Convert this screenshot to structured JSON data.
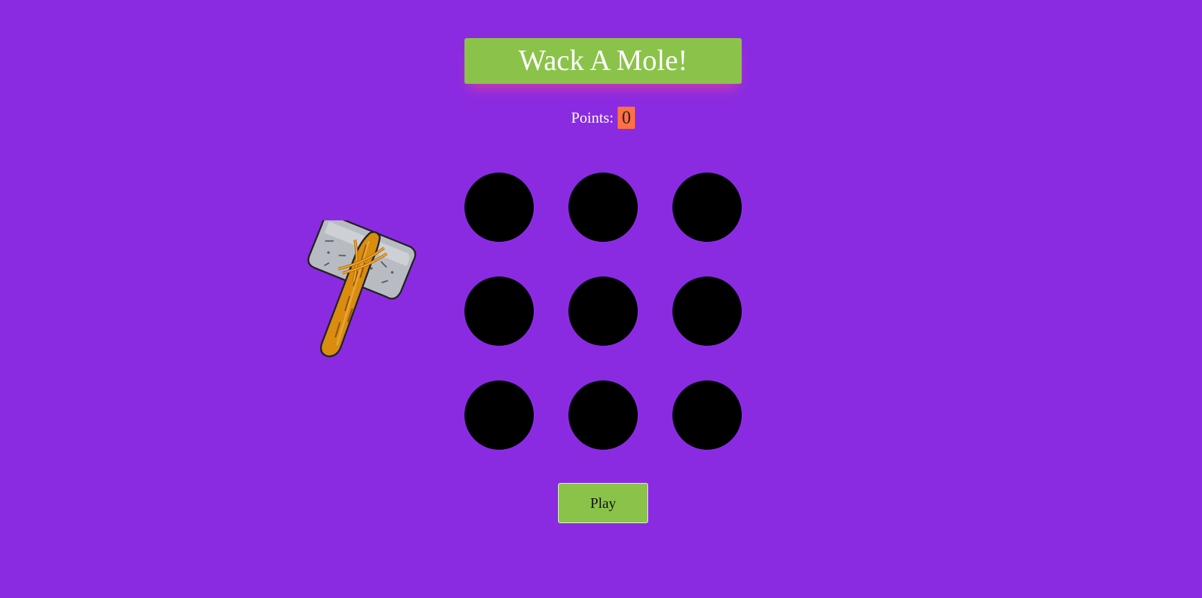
{
  "game": {
    "title": "Wack A Mole!",
    "points_label": "Points:",
    "points_value": "0",
    "play_label": "Play",
    "holes": 9,
    "cursor_icon": "hammer-icon"
  },
  "colors": {
    "background": "#8a2be2",
    "accent_green": "#8bc34a",
    "points_badge": "#ff7043",
    "hole": "#000000"
  }
}
